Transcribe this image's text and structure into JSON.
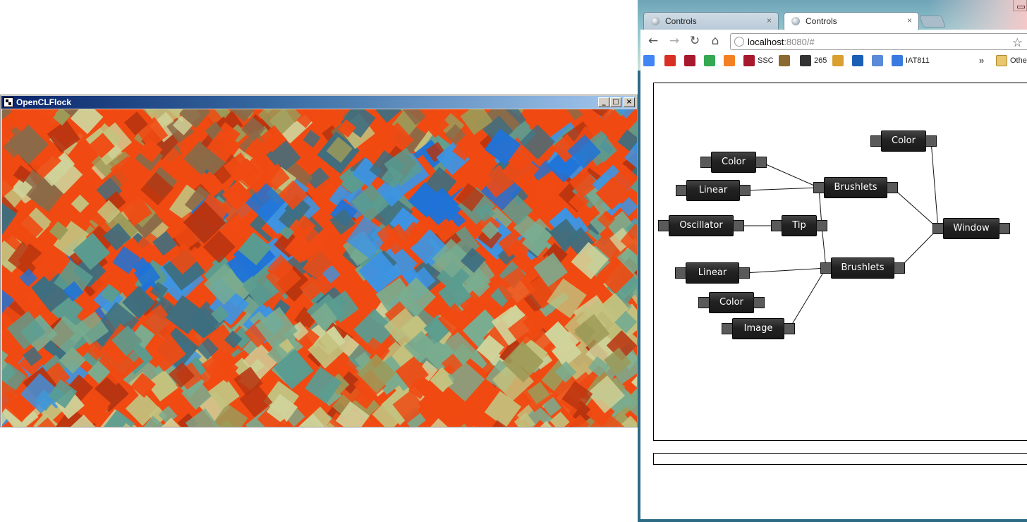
{
  "flock_window": {
    "title": "OpenCLFlock",
    "controls": {
      "minimize": "_",
      "maximize": "□",
      "close": "×"
    },
    "palette": {
      "orange": "#f04a12",
      "dark_orange": "#b83410",
      "blue": "#1e72d8",
      "sky": "#3d94e3",
      "teal": "#5a9c90",
      "sage": "#7aac8f",
      "olive": "#9c9a58",
      "khaki": "#c3c27e",
      "pale": "#cfd39a",
      "brown": "#8a6a48",
      "slate": "#3d6e80"
    }
  },
  "browser": {
    "tabs": [
      {
        "label": "Controls",
        "active": false,
        "close": "×"
      },
      {
        "label": "Controls",
        "active": true,
        "close": "×"
      }
    ],
    "nav": {
      "back": "←",
      "forward": "→",
      "reload": "↻",
      "home": "⌂",
      "star": "☆"
    },
    "address": {
      "host": "localhost",
      "rest": ":8080/#"
    },
    "bookmarks": [
      {
        "label": "",
        "icon": "google-icon",
        "color": "#4285f4"
      },
      {
        "label": "",
        "icon": "gmail-icon",
        "color": "#d93025"
      },
      {
        "label": "",
        "icon": "sfu-icon",
        "color": "#a6192e"
      },
      {
        "label": "",
        "icon": "play-store-icon",
        "color": "#34a853"
      },
      {
        "label": "",
        "icon": "stack-icon",
        "color": "#f48024"
      },
      {
        "label": "SSC",
        "icon": "sfu-icon",
        "color": "#a6192e"
      },
      {
        "label": "",
        "icon": "chart-icon",
        "color": "#8a6a30"
      },
      {
        "label": "265",
        "icon": "runner-icon",
        "color": "#333333"
      },
      {
        "label": "",
        "icon": "mp-icon",
        "color": "#d9a030"
      },
      {
        "label": "",
        "icon": "nine-icon",
        "color": "#1a5fb4"
      },
      {
        "label": "",
        "icon": "document-icon",
        "color": "#5a8ad8"
      },
      {
        "label": "IAT811",
        "icon": "doc-blue-icon",
        "color": "#3a7ae0"
      }
    ],
    "bookmarks_overflow": "»",
    "other_bookmarks": "Othe"
  },
  "graph": {
    "nodes": [
      {
        "id": "color1",
        "label": "Color"
      },
      {
        "id": "color2",
        "label": "Color"
      },
      {
        "id": "linear1",
        "label": "Linear"
      },
      {
        "id": "brushlets1",
        "label": "Brushlets"
      },
      {
        "id": "oscillator",
        "label": "Oscillator"
      },
      {
        "id": "tip",
        "label": "Tip"
      },
      {
        "id": "window",
        "label": "Window"
      },
      {
        "id": "linear2",
        "label": "Linear"
      },
      {
        "id": "brushlets2",
        "label": "Brushlets"
      },
      {
        "id": "color3",
        "label": "Color"
      },
      {
        "id": "image",
        "label": "Image"
      }
    ],
    "edges": [
      [
        "color1",
        "brushlets1"
      ],
      [
        "linear1",
        "brushlets1"
      ],
      [
        "oscillator",
        "tip"
      ],
      [
        "tip",
        "brushlets1"
      ],
      [
        "tip",
        "brushlets2"
      ],
      [
        "linear2",
        "brushlets2"
      ],
      [
        "image",
        "brushlets2"
      ],
      [
        "brushlets1",
        "window"
      ],
      [
        "brushlets2",
        "window"
      ],
      [
        "color2",
        "window"
      ]
    ]
  }
}
